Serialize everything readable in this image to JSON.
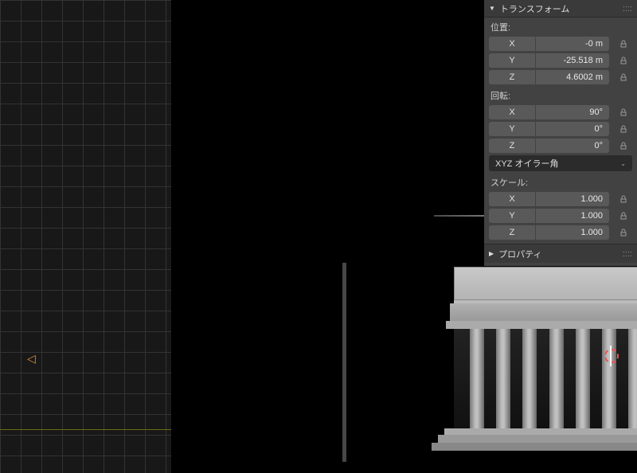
{
  "panel": {
    "transform_title": "トランスフォーム",
    "properties_title": "プロパティ",
    "position_label": "位置:",
    "rotation_label": "回転:",
    "scale_label": "スケール:",
    "rotation_mode": "XYZ オイラー角",
    "axes": {
      "x": "X",
      "y": "Y",
      "z": "Z"
    },
    "location": {
      "x": "-0 m",
      "y": "-25.518 m",
      "z": "4.6002 m"
    },
    "rotation": {
      "x": "90°",
      "y": "0°",
      "z": "0°"
    },
    "scale": {
      "x": "1.000",
      "y": "1.000",
      "z": "1.000"
    }
  }
}
